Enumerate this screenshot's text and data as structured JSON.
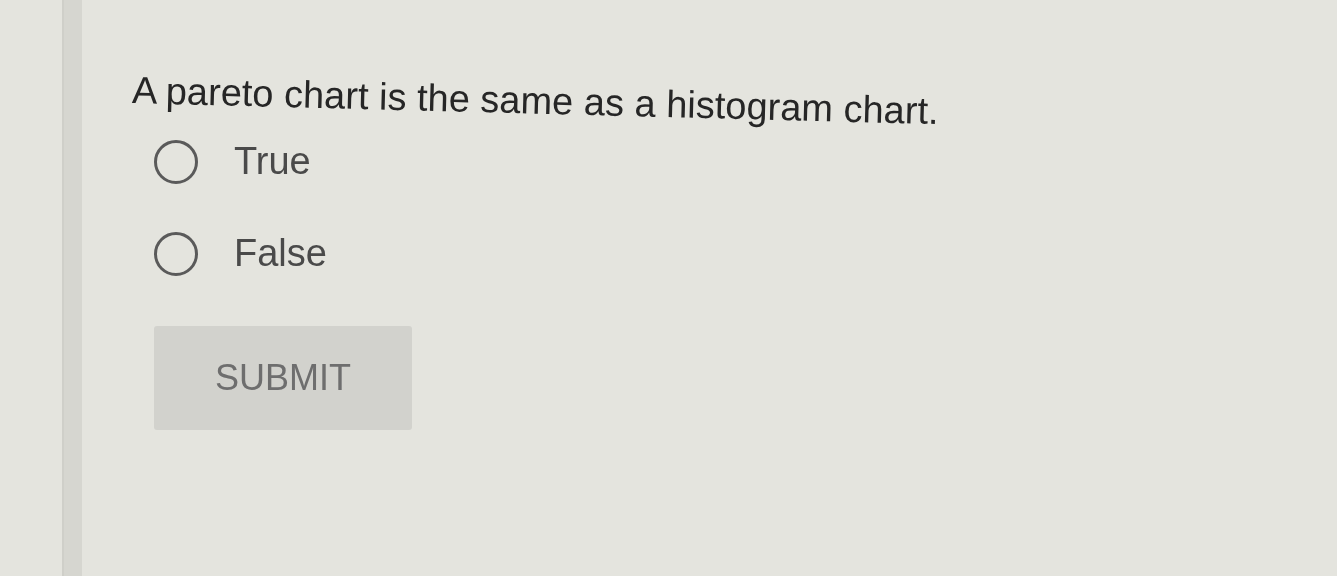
{
  "question": "A pareto chart is the same as a histogram chart.",
  "options": [
    {
      "label": "True",
      "selected": false
    },
    {
      "label": "False",
      "selected": false
    }
  ],
  "submit": {
    "label": "SUBMIT",
    "disabled": true
  }
}
